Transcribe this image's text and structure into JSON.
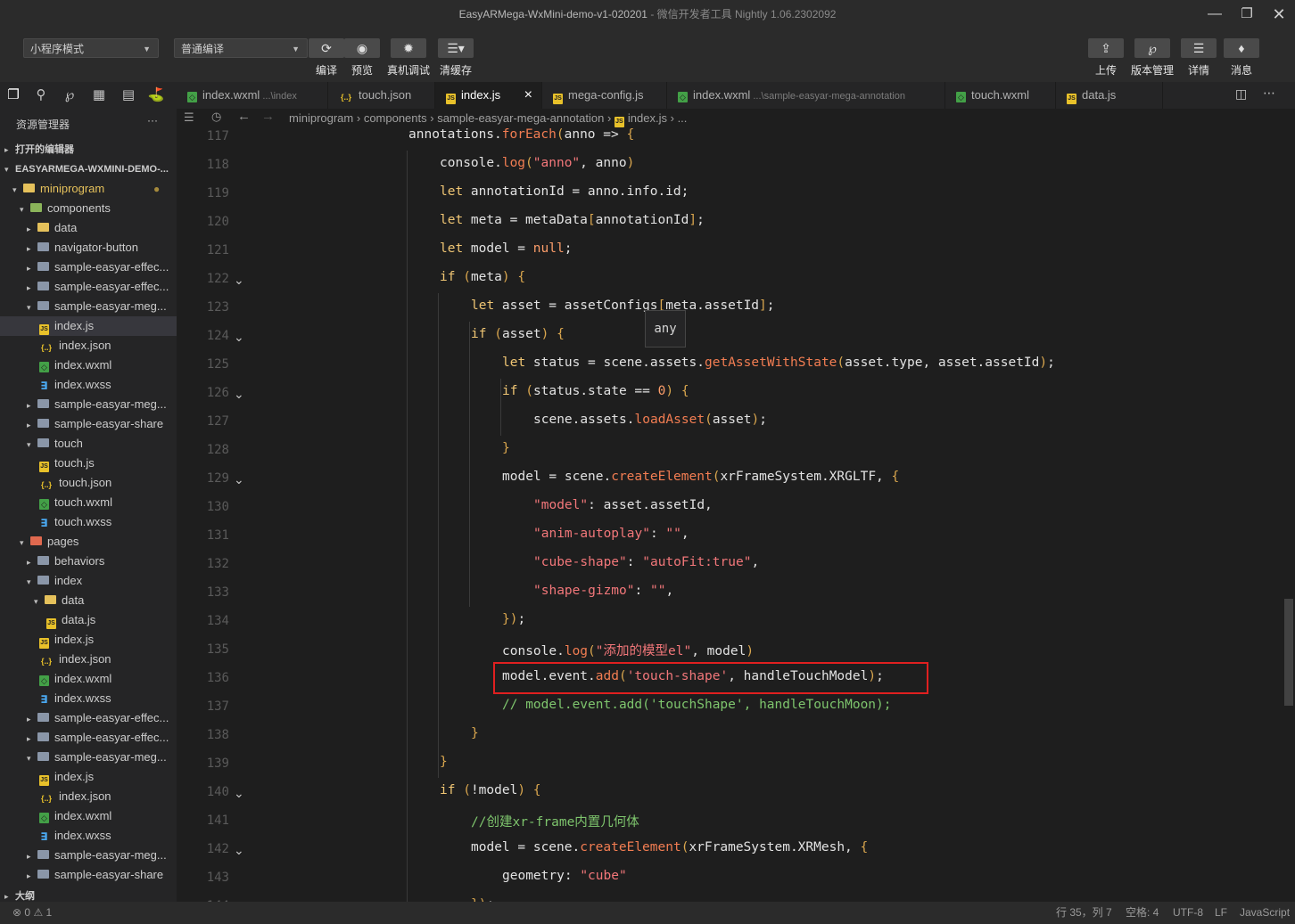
{
  "window": {
    "title": "EasyARMega-WxMini-demo-v1-020201",
    "subtitle": "- 微信开发者工具 Nightly 1.06.2302092",
    "minimize_icon": "minimize-icon",
    "restore_icon": "restore-icon",
    "close_icon": "close-icon"
  },
  "toolbar": {
    "mode_select": "小程序模式",
    "compile_select": "普通编译",
    "buttons": [
      {
        "label": "编译",
        "icon": "refresh-icon"
      },
      {
        "label": "预览",
        "icon": "eye-icon"
      },
      {
        "label": "真机调试",
        "icon": "bug-icon"
      },
      {
        "label": "清缓存",
        "icon": "layers-icon"
      }
    ],
    "right_buttons": [
      {
        "label": "上传",
        "icon": "upload-icon"
      },
      {
        "label": "版本管理",
        "icon": "branch-icon"
      },
      {
        "label": "详情",
        "icon": "menu-icon"
      },
      {
        "label": "消息",
        "icon": "bell-icon"
      }
    ]
  },
  "tabs": [
    {
      "name": "index.wxml",
      "hint": "...\\index",
      "type": "wxml",
      "active": false
    },
    {
      "name": "touch.json",
      "hint": "",
      "type": "json",
      "active": false
    },
    {
      "name": "index.js",
      "hint": "",
      "type": "js",
      "active": true
    },
    {
      "name": "mega-config.js",
      "hint": "",
      "type": "js",
      "active": false
    },
    {
      "name": "index.wxml",
      "hint": "...\\sample-easyar-mega-annotation",
      "type": "wxml",
      "active": false
    },
    {
      "name": "touch.wxml",
      "hint": "",
      "type": "wxml",
      "active": false
    },
    {
      "name": "data.js",
      "hint": "",
      "type": "js",
      "active": false
    }
  ],
  "tab_close": "×",
  "sidebar": {
    "title": "资源管理器",
    "more": "···",
    "open_editors": "打开的编辑器",
    "project": "EASYARMEGA-WXMINI-DEMO-...",
    "outline": "大纲",
    "tree": [
      {
        "label": "miniprogram",
        "depth": 1,
        "kind": "folder-open",
        "color": "y",
        "twisty": "▾",
        "modified": true
      },
      {
        "label": "components",
        "depth": 2,
        "kind": "folder-open",
        "color": "g",
        "twisty": "▾"
      },
      {
        "label": "data",
        "depth": 3,
        "kind": "folder",
        "color": "y",
        "twisty": "▸"
      },
      {
        "label": "navigator-button",
        "depth": 3,
        "kind": "folder",
        "color": "",
        "twisty": "▸"
      },
      {
        "label": "sample-easyar-effec...",
        "depth": 3,
        "kind": "folder",
        "color": "",
        "twisty": "▸"
      },
      {
        "label": "sample-easyar-effec...",
        "depth": 3,
        "kind": "folder",
        "color": "",
        "twisty": "▸"
      },
      {
        "label": "sample-easyar-meg...",
        "depth": 3,
        "kind": "folder-open",
        "color": "",
        "twisty": "▾"
      },
      {
        "label": "index.js",
        "depth": 4,
        "kind": "js",
        "selected": true
      },
      {
        "label": "index.json",
        "depth": 4,
        "kind": "json"
      },
      {
        "label": "index.wxml",
        "depth": 4,
        "kind": "wxml"
      },
      {
        "label": "index.wxss",
        "depth": 4,
        "kind": "wxss"
      },
      {
        "label": "sample-easyar-meg...",
        "depth": 3,
        "kind": "folder",
        "color": "",
        "twisty": "▸"
      },
      {
        "label": "sample-easyar-share",
        "depth": 3,
        "kind": "folder",
        "color": "",
        "twisty": "▸"
      },
      {
        "label": "touch",
        "depth": 3,
        "kind": "folder-open",
        "color": "",
        "twisty": "▾"
      },
      {
        "label": "touch.js",
        "depth": 4,
        "kind": "js"
      },
      {
        "label": "touch.json",
        "depth": 4,
        "kind": "json"
      },
      {
        "label": "touch.wxml",
        "depth": 4,
        "kind": "wxml"
      },
      {
        "label": "touch.wxss",
        "depth": 4,
        "kind": "wxss"
      },
      {
        "label": "pages",
        "depth": 2,
        "kind": "folder-open",
        "color": "r",
        "twisty": "▾"
      },
      {
        "label": "behaviors",
        "depth": 3,
        "kind": "folder",
        "color": "",
        "twisty": "▸"
      },
      {
        "label": "index",
        "depth": 3,
        "kind": "folder-open",
        "color": "",
        "twisty": "▾"
      },
      {
        "label": "data",
        "depth": 4,
        "kind": "folder-open",
        "color": "y",
        "twisty": "▾"
      },
      {
        "label": "data.js",
        "depth": 5,
        "kind": "js"
      },
      {
        "label": "index.js",
        "depth": 4,
        "kind": "js"
      },
      {
        "label": "index.json",
        "depth": 4,
        "kind": "json"
      },
      {
        "label": "index.wxml",
        "depth": 4,
        "kind": "wxml"
      },
      {
        "label": "index.wxss",
        "depth": 4,
        "kind": "wxss"
      },
      {
        "label": "sample-easyar-effec...",
        "depth": 3,
        "kind": "folder",
        "color": "",
        "twisty": "▸"
      },
      {
        "label": "sample-easyar-effec...",
        "depth": 3,
        "kind": "folder",
        "color": "",
        "twisty": "▸"
      },
      {
        "label": "sample-easyar-meg...",
        "depth": 3,
        "kind": "folder-open",
        "color": "",
        "twisty": "▾"
      },
      {
        "label": "index.js",
        "depth": 4,
        "kind": "js"
      },
      {
        "label": "index.json",
        "depth": 4,
        "kind": "json"
      },
      {
        "label": "index.wxml",
        "depth": 4,
        "kind": "wxml"
      },
      {
        "label": "index.wxss",
        "depth": 4,
        "kind": "wxss"
      },
      {
        "label": "sample-easyar-meg...",
        "depth": 3,
        "kind": "folder",
        "color": "",
        "twisty": "▸"
      },
      {
        "label": "sample-easyar-share",
        "depth": 3,
        "kind": "folder",
        "color": "",
        "twisty": "▸"
      }
    ]
  },
  "breadcrumb": [
    "miniprogram",
    "components",
    "sample-easyar-mega-annotation",
    "index.js",
    "..."
  ],
  "editor": {
    "hover_tooltip": "any",
    "highlight_color": "#e02020",
    "lines": [
      {
        "n": "117",
        "indent": 5,
        "fold": false,
        "tokens": [
          [
            "p",
            "annotations."
          ],
          [
            "f",
            "forEach"
          ],
          [
            "br",
            "("
          ],
          [
            "p",
            "anno => "
          ],
          [
            "br",
            "{"
          ]
        ]
      },
      {
        "n": "118",
        "indent": 6,
        "fold": false,
        "tokens": [
          [
            "p",
            "console."
          ],
          [
            "f",
            "log"
          ],
          [
            "br",
            "("
          ],
          [
            "s",
            "\"anno\""
          ],
          [
            "p",
            ", anno"
          ],
          [
            "br",
            ")"
          ]
        ]
      },
      {
        "n": "119",
        "indent": 6,
        "fold": false,
        "tokens": [
          [
            "k",
            "let"
          ],
          [
            "p",
            " annotationId = anno.info.id;"
          ]
        ]
      },
      {
        "n": "120",
        "indent": 6,
        "fold": false,
        "tokens": [
          [
            "k",
            "let"
          ],
          [
            "p",
            " meta = metaData"
          ],
          [
            "br",
            "["
          ],
          [
            "p",
            "annotationId"
          ],
          [
            "br",
            "]"
          ],
          [
            "p",
            ";"
          ]
        ]
      },
      {
        "n": "121",
        "indent": 6,
        "fold": false,
        "tokens": [
          [
            "k",
            "let"
          ],
          [
            "p",
            " model = "
          ],
          [
            "n",
            "null"
          ],
          [
            "p",
            ";"
          ]
        ]
      },
      {
        "n": "122",
        "indent": 6,
        "fold": true,
        "tokens": [
          [
            "k",
            "if"
          ],
          [
            "p",
            " "
          ],
          [
            "br",
            "("
          ],
          [
            "p",
            "meta"
          ],
          [
            "br",
            ")"
          ],
          [
            "p",
            " "
          ],
          [
            "br",
            "{"
          ]
        ]
      },
      {
        "n": "123",
        "indent": 7,
        "fold": false,
        "tokens": [
          [
            "k",
            "let"
          ],
          [
            "p",
            " asset = assetConfigs"
          ],
          [
            "br",
            "["
          ],
          [
            "p",
            "meta.assetId"
          ],
          [
            "br",
            "]"
          ],
          [
            "p",
            ";"
          ]
        ]
      },
      {
        "n": "124",
        "indent": 7,
        "fold": true,
        "tokens": [
          [
            "k",
            "if"
          ],
          [
            "p",
            " "
          ],
          [
            "br",
            "("
          ],
          [
            "p",
            "asset"
          ],
          [
            "br",
            ")"
          ],
          [
            "p",
            " "
          ],
          [
            "br",
            "{"
          ]
        ]
      },
      {
        "n": "125",
        "indent": 8,
        "fold": false,
        "tokens": [
          [
            "k",
            "let"
          ],
          [
            "p",
            " status = scene.assets."
          ],
          [
            "f",
            "getAssetWithState"
          ],
          [
            "br",
            "("
          ],
          [
            "p",
            "asset.type, asset.assetId"
          ],
          [
            "br",
            ")"
          ],
          [
            "p",
            ";"
          ]
        ]
      },
      {
        "n": "126",
        "indent": 8,
        "fold": true,
        "tokens": [
          [
            "k",
            "if"
          ],
          [
            "p",
            " "
          ],
          [
            "br",
            "("
          ],
          [
            "p",
            "status.state == "
          ],
          [
            "n",
            "0"
          ],
          [
            "br",
            ")"
          ],
          [
            "p",
            " "
          ],
          [
            "br",
            "{"
          ]
        ]
      },
      {
        "n": "127",
        "indent": 9,
        "fold": false,
        "tokens": [
          [
            "p",
            "scene.assets."
          ],
          [
            "f",
            "loadAsset"
          ],
          [
            "br",
            "("
          ],
          [
            "p",
            "asset"
          ],
          [
            "br",
            ")"
          ],
          [
            "p",
            ";"
          ]
        ]
      },
      {
        "n": "128",
        "indent": 8,
        "fold": false,
        "tokens": [
          [
            "br",
            "}"
          ]
        ]
      },
      {
        "n": "129",
        "indent": 8,
        "fold": true,
        "tokens": [
          [
            "p",
            "model = scene."
          ],
          [
            "f",
            "createElement"
          ],
          [
            "br",
            "("
          ],
          [
            "p",
            "xrFrameSystem.XRGLTF, "
          ],
          [
            "br",
            "{"
          ]
        ]
      },
      {
        "n": "130",
        "indent": 9,
        "fold": false,
        "tokens": [
          [
            "s",
            "\"model\""
          ],
          [
            "p",
            ": asset.assetId,"
          ]
        ]
      },
      {
        "n": "131",
        "indent": 9,
        "fold": false,
        "tokens": [
          [
            "s",
            "\"anim-autoplay\""
          ],
          [
            "p",
            ": "
          ],
          [
            "s",
            "\"\""
          ],
          [
            "p",
            ","
          ]
        ]
      },
      {
        "n": "132",
        "indent": 9,
        "fold": false,
        "tokens": [
          [
            "s",
            "\"cube-shape\""
          ],
          [
            "p",
            ": "
          ],
          [
            "s",
            "\"autoFit:true\""
          ],
          [
            "p",
            ","
          ]
        ]
      },
      {
        "n": "133",
        "indent": 9,
        "fold": false,
        "tokens": [
          [
            "s",
            "\"shape-gizmo\""
          ],
          [
            "p",
            ": "
          ],
          [
            "s",
            "\"\""
          ],
          [
            "p",
            ","
          ]
        ]
      },
      {
        "n": "134",
        "indent": 8,
        "fold": false,
        "tokens": [
          [
            "br",
            "}"
          ],
          [
            "br",
            ")"
          ],
          [
            "p",
            ";"
          ]
        ]
      },
      {
        "n": "135",
        "indent": 8,
        "fold": false,
        "tokens": [
          [
            "p",
            "console."
          ],
          [
            "f",
            "log"
          ],
          [
            "br",
            "("
          ],
          [
            "s",
            "\"添加的模型el\""
          ],
          [
            "p",
            ", model"
          ],
          [
            "br",
            ")"
          ]
        ]
      },
      {
        "n": "136",
        "indent": 8,
        "fold": false,
        "highlight": true,
        "tokens": [
          [
            "p",
            "model.event."
          ],
          [
            "f",
            "add"
          ],
          [
            "br",
            "("
          ],
          [
            "s",
            "'touch-shape'"
          ],
          [
            "p",
            ", handleTouchModel"
          ],
          [
            "br",
            ")"
          ],
          [
            "p",
            ";"
          ]
        ]
      },
      {
        "n": "137",
        "indent": 8,
        "fold": false,
        "tokens": [
          [
            "c",
            "// model.event.add('touchShape', handleTouchMoon);"
          ]
        ]
      },
      {
        "n": "138",
        "indent": 7,
        "fold": false,
        "tokens": [
          [
            "br",
            "}"
          ]
        ]
      },
      {
        "n": "139",
        "indent": 6,
        "fold": false,
        "tokens": [
          [
            "br",
            "}"
          ]
        ]
      },
      {
        "n": "140",
        "indent": 6,
        "fold": true,
        "tokens": [
          [
            "k",
            "if"
          ],
          [
            "p",
            " "
          ],
          [
            "br",
            "("
          ],
          [
            "p",
            "!model"
          ],
          [
            "br",
            ")"
          ],
          [
            "p",
            " "
          ],
          [
            "br",
            "{"
          ]
        ]
      },
      {
        "n": "141",
        "indent": 7,
        "fold": false,
        "tokens": [
          [
            "c",
            "//创建xr-frame内置几何体"
          ]
        ]
      },
      {
        "n": "142",
        "indent": 7,
        "fold": true,
        "tokens": [
          [
            "p",
            "model = scene."
          ],
          [
            "f",
            "createElement"
          ],
          [
            "br",
            "("
          ],
          [
            "p",
            "xrFrameSystem.XRMesh, "
          ],
          [
            "br",
            "{"
          ]
        ]
      },
      {
        "n": "143",
        "indent": 8,
        "fold": false,
        "tokens": [
          [
            "p",
            "geometry: "
          ],
          [
            "s",
            "\"cube\""
          ]
        ]
      },
      {
        "n": "144",
        "indent": 7,
        "fold": false,
        "tokens": [
          [
            "br",
            "}"
          ],
          [
            "br",
            ")"
          ],
          [
            "p",
            ";"
          ]
        ]
      }
    ]
  },
  "statusbar": {
    "errors": "0",
    "warnings": "1",
    "position": "行 35，列 7",
    "indent": "空格: 4",
    "encoding": "UTF-8",
    "eol": "LF",
    "language": "JavaScript"
  }
}
